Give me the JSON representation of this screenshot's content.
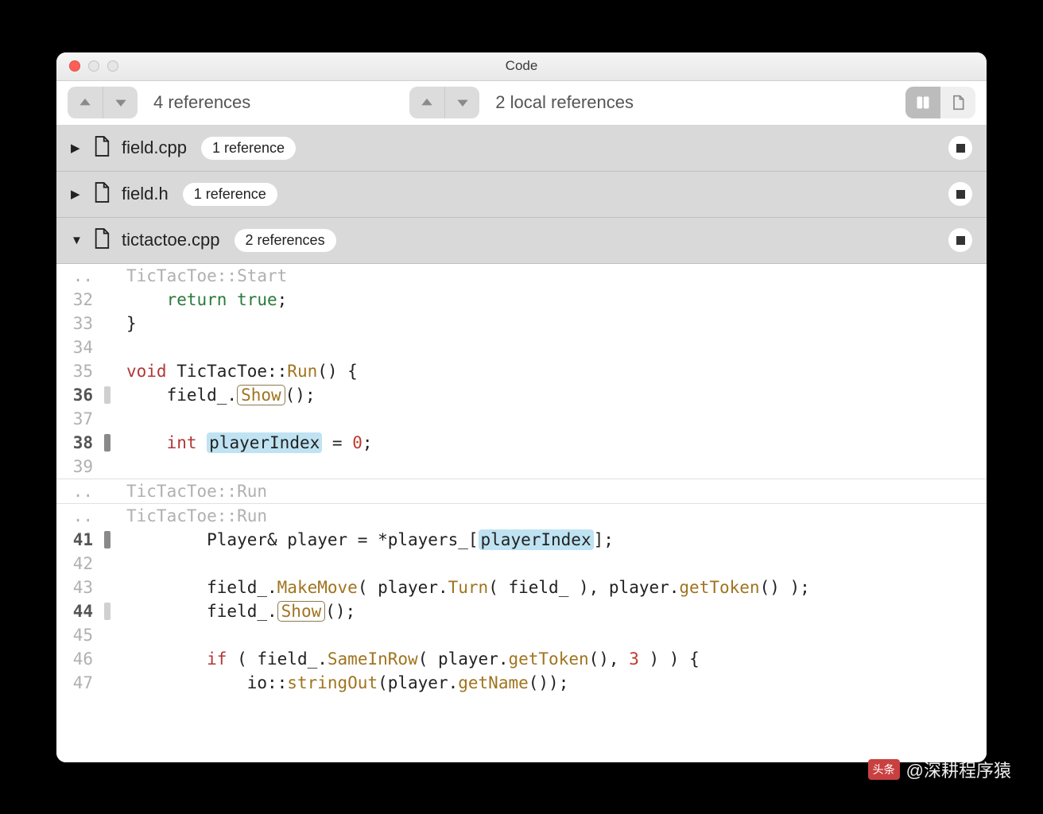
{
  "window": {
    "title": "Code"
  },
  "toolbar": {
    "refs_left": "4 references",
    "refs_right": "2 local references"
  },
  "files": [
    {
      "name": "field.cpp",
      "badge": "1 reference",
      "expanded": false
    },
    {
      "name": "field.h",
      "badge": "1 reference",
      "expanded": false
    },
    {
      "name": "tictactoe.cpp",
      "badge": "2 references",
      "expanded": true
    }
  ],
  "code": {
    "context_top": "TicTacToe::Start",
    "context_mid1": "TicTacToe::Run",
    "context_mid2": "TicTacToe::Run",
    "lines": {
      "l32a": "    ",
      "l32b": "return",
      "l32c": " ",
      "l32d": "true",
      "l32e": ";",
      "l33": "}",
      "l34": "",
      "l35a": "void",
      "l35b": " TicTacToe::",
      "l35c": "Run",
      "l35d": "() {",
      "l36a": "    field_.",
      "l36b": "Show",
      "l36c": "();",
      "l37": "",
      "l38a": "    ",
      "l38b": "int",
      "l38c": " ",
      "l38d": "playerIndex",
      "l38e": " = ",
      "l38f": "0",
      "l38g": ";",
      "l39": "",
      "l41a": "        Player& player = *players_[",
      "l41b": "playerIndex",
      "l41c": "];",
      "l42": "",
      "l43a": "        field_.",
      "l43b": "MakeMove",
      "l43c": "( player.",
      "l43d": "Turn",
      "l43e": "( field_ ), player.",
      "l43f": "getToken",
      "l43g": "() );",
      "l44a": "        field_.",
      "l44b": "Show",
      "l44c": "();",
      "l45": "",
      "l46a": "        ",
      "l46b": "if",
      "l46c": " ( field_.",
      "l46d": "SameInRow",
      "l46e": "( player.",
      "l46f": "getToken",
      "l46g": "(), ",
      "l46h": "3",
      "l46i": " ) ) {",
      "l47a": "            io::",
      "l47b": "stringOut",
      "l47c": "(player.",
      "l47d": "getName",
      "l47e": "());"
    },
    "gutters": {
      "dots": "..",
      "g32": "32",
      "g33": "33",
      "g34": "34",
      "g35": "35",
      "g36": "36",
      "g37": "37",
      "g38": "38",
      "g39": "39",
      "g41": "41",
      "g42": "42",
      "g43": "43",
      "g44": "44",
      "g45": "45",
      "g46": "46",
      "g47": "47"
    }
  },
  "watermark": {
    "logo": "头条",
    "text": "@深耕程序猿"
  }
}
